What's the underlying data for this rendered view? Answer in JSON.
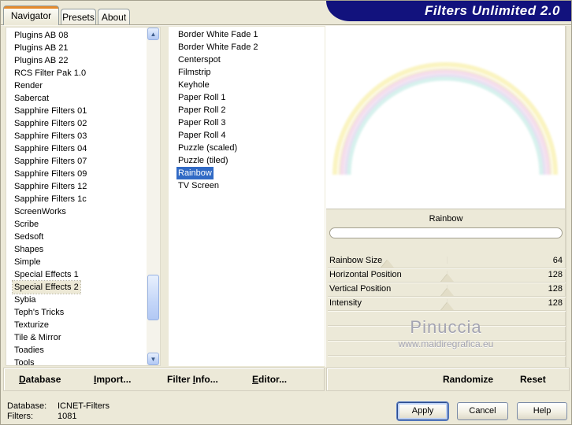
{
  "window": {
    "title": "Filters Unlimited 2.0"
  },
  "tabs": {
    "navigator": "Navigator",
    "presets": "Presets",
    "about": "About"
  },
  "left_list": {
    "selected": "Special Effects 2",
    "selected_index": 20,
    "items": [
      "Plugins AB 08",
      "Plugins AB 21",
      "Plugins AB 22",
      "RCS Filter Pak 1.0",
      "Render",
      "Sabercat",
      "Sapphire Filters 01",
      "Sapphire Filters 02",
      "Sapphire Filters 03",
      "Sapphire Filters 04",
      "Sapphire Filters 07",
      "Sapphire Filters 09",
      "Sapphire Filters 12",
      "Sapphire Filters 1c",
      "ScreenWorks",
      "Scribe",
      "Sedsoft",
      "Shapes",
      "Simple",
      "Special Effects 1",
      "Special Effects 2",
      "Sybia",
      "Teph's Tricks",
      "Texturize",
      "Tile & Mirror",
      "Toadies",
      "Tools"
    ]
  },
  "filter_list": {
    "selected": "Rainbow",
    "selected_index": 11,
    "items": [
      "Border White Fade 1",
      "Border White Fade 2",
      "Centerspot",
      "Filmstrip",
      "Keyhole",
      "Paper Roll 1",
      "Paper Roll 2",
      "Paper Roll 3",
      "Paper Roll 4",
      "Puzzle (scaled)",
      "Puzzle (tiled)",
      "Rainbow",
      "TV Screen"
    ]
  },
  "preview": {
    "filter_name": "Rainbow"
  },
  "sliders": {
    "max": 255,
    "items": [
      {
        "label": "Rainbow Size",
        "value": 64
      },
      {
        "label": "Horizontal Position",
        "value": 128
      },
      {
        "label": "Vertical Position",
        "value": 128
      },
      {
        "label": "Intensity",
        "value": 128
      }
    ],
    "empty_rows": 3
  },
  "watermark": {
    "line1": "Pinuccia",
    "line2": "www.maidiregrafica.eu"
  },
  "toolbar": {
    "database": {
      "label": "Database",
      "accel_index": 0
    },
    "import": {
      "label": "Import...",
      "accel_index": 0
    },
    "filterinfo": {
      "label": "Filter Info...",
      "accel_index": 7
    },
    "editor": {
      "label": "Editor...",
      "accel_index": 0
    },
    "randomize": {
      "label": "Randomize",
      "accel_index": -1
    },
    "reset": {
      "label": "Reset",
      "accel_index": -1
    }
  },
  "status": {
    "database_label": "Database:",
    "database_value": "ICNET-Filters",
    "filters_label": "Filters:",
    "filters_value": "1081"
  },
  "dialog_buttons": {
    "apply": "Apply",
    "cancel": "Cancel",
    "help": "Help"
  },
  "scrollbar": {
    "up_icon": "▲",
    "down_icon": "▼"
  },
  "colors": {
    "header_navy": "#12127D",
    "tab_accent_orange": "#E68B2C",
    "selection_blue": "#316AC5",
    "dialog_beige": "#ECE9D8",
    "rainbow_yellow": "#F9F2B6",
    "rainbow_pink": "#F3D7E8",
    "rainbow_lavender": "#E3D9F0",
    "rainbow_cyan": "#CFEFEA"
  }
}
